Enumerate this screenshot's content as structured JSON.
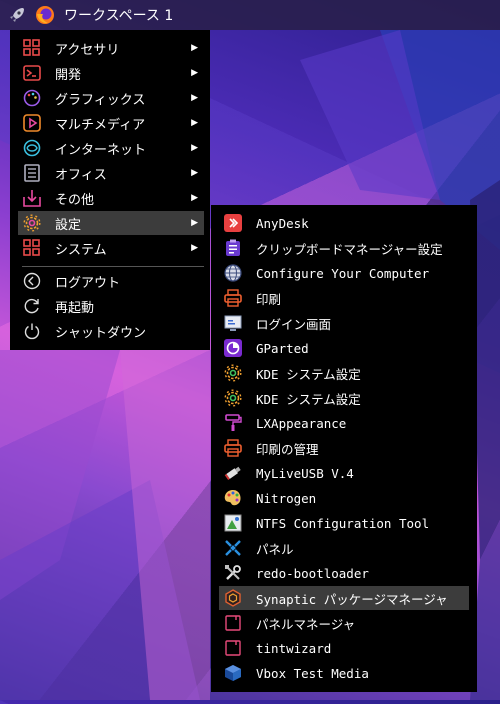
{
  "taskbar": {
    "title": "ワークスペース 1",
    "icons": [
      "rocket-icon",
      "firefox-icon"
    ]
  },
  "main_menu": {
    "items": [
      {
        "label": "アクセサリ",
        "icon": "grid-icon",
        "arrow": "▶"
      },
      {
        "label": "開発",
        "icon": "terminal-icon",
        "arrow": "▶"
      },
      {
        "label": "グラフィックス",
        "icon": "palette-icon",
        "arrow": "▶"
      },
      {
        "label": "マルチメディア",
        "icon": "play-icon",
        "arrow": "▶"
      },
      {
        "label": "インターネット",
        "icon": "globe-icon",
        "arrow": "▶"
      },
      {
        "label": "オフィス",
        "icon": "document-icon",
        "arrow": "▶"
      },
      {
        "label": "その他",
        "icon": "download-box-icon",
        "arrow": "▶"
      },
      {
        "label": "設定",
        "icon": "gear-icon",
        "arrow": "▶",
        "selected": true
      },
      {
        "label": "システム",
        "icon": "grid-icon",
        "arrow": "▶"
      }
    ],
    "session": [
      {
        "label": "ログアウト",
        "icon": "logout-icon"
      },
      {
        "label": "再起動",
        "icon": "restart-icon"
      },
      {
        "label": "シャットダウン",
        "icon": "power-icon"
      }
    ]
  },
  "sub_menu": {
    "items": [
      {
        "label": "AnyDesk",
        "icon": "anydesk-icon"
      },
      {
        "label": "クリップボードマネージャー設定",
        "icon": "clipboard-icon"
      },
      {
        "label": "Configure Your Computer",
        "icon": "globe-settings-icon"
      },
      {
        "label": "印刷",
        "icon": "printer-icon"
      },
      {
        "label": "ログイン画面",
        "icon": "login-screen-icon"
      },
      {
        "label": "GParted",
        "icon": "gparted-icon"
      },
      {
        "label": "KDE システム設定",
        "icon": "gear-icon"
      },
      {
        "label": "KDE システム設定",
        "icon": "gear-icon"
      },
      {
        "label": "LXAppearance",
        "icon": "paint-roller-icon"
      },
      {
        "label": "印刷の管理",
        "icon": "printer-icon"
      },
      {
        "label": "MyLiveUSB V.4",
        "icon": "usb-icon"
      },
      {
        "label": "Nitrogen",
        "icon": "palette-icon"
      },
      {
        "label": "NTFS Configuration Tool",
        "icon": "ntfs-icon"
      },
      {
        "label": "パネル",
        "icon": "panel-icon"
      },
      {
        "label": "redo-bootloader",
        "icon": "tools-icon"
      },
      {
        "label": "Synaptic パッケージマネージャ",
        "icon": "synaptic-icon",
        "selected": true
      },
      {
        "label": "パネルマネージャ",
        "icon": "panel-manager-icon"
      },
      {
        "label": "tintwizard",
        "icon": "tintwizard-icon"
      },
      {
        "label": "Vbox Test Media",
        "icon": "virtualbox-icon"
      }
    ]
  },
  "colors": {
    "accent": "#e04040",
    "menu_bg": "#000000",
    "selected_bg": "#3c3c3c"
  }
}
